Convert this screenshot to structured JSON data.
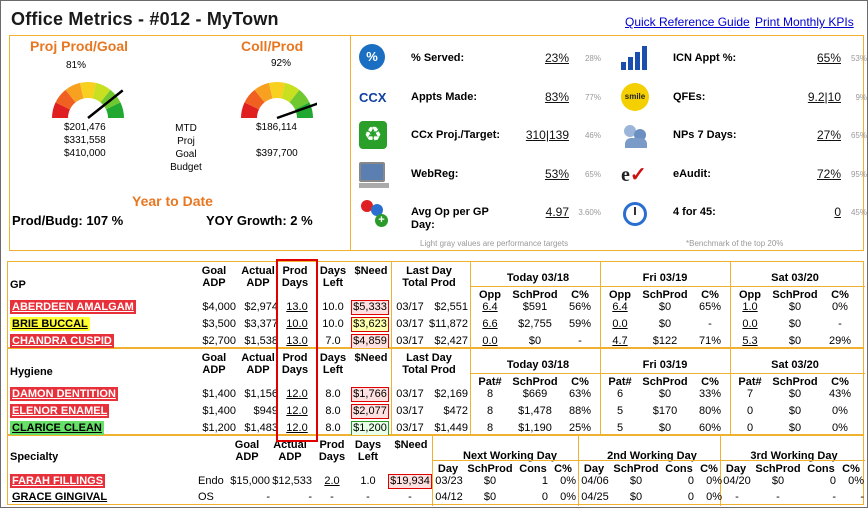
{
  "header": {
    "title": "Office Metrics - #012 - MyTown",
    "link1": "Quick Reference Guide",
    "link2": "Print Monthly KPIs"
  },
  "gauges": {
    "g1": {
      "title": "Proj Prod/Goal",
      "pct": "81%",
      "level": 0.81,
      "v1": "$201,476",
      "v2": "$331,558",
      "v3": "$410,000"
    },
    "g2": {
      "title": "Coll/Prod",
      "pct": "92%",
      "level": 0.92,
      "v1": "$186,114",
      "v2": "$397,700"
    },
    "labels": {
      "l1": "MTD",
      "l2": "Proj",
      "l3": "Goal",
      "l4": "Budget"
    },
    "ytd": "Year to Date",
    "prod_budg": "Prod/Budg: 107 %",
    "yoy": "YOY Growth: 2 %"
  },
  "kpis": {
    "left": [
      {
        "label": "% Served:",
        "value": "23%",
        "bench": "28%",
        "icon": "percent-icon",
        "color": "#1b6fc2"
      },
      {
        "label": "Appts Made:",
        "value": "83%",
        "bench": "77%",
        "icon": "ccx-icon",
        "color": "#1040a0"
      },
      {
        "label": "CCx Proj./Target:",
        "value": "310|139",
        "bench": "46%",
        "icon": "recycle-icon",
        "color": "#2aa02a"
      },
      {
        "label": "WebReg:",
        "value": "53%",
        "bench": "65%",
        "icon": "computer-icon",
        "color": "#5a7fb0"
      },
      {
        "label": "Avg Op per GP Day:",
        "value": "4.97",
        "bench": "3.60%",
        "icon": "people-add-icon",
        "color": "#2a6fd0"
      }
    ],
    "right": [
      {
        "label": "ICN Appt %:",
        "value": "65%",
        "bench": "53%",
        "icon": "bar-chart-icon",
        "color": "#1a4fb0"
      },
      {
        "label": "QFEs:",
        "value": "9.2|10",
        "bench": "9%",
        "icon": "smile-icon",
        "color": "#f5d000"
      },
      {
        "label": "NPs 7 Days:",
        "value": "27%",
        "bench": "65%",
        "icon": "new-patients-icon",
        "color": "#6a8fc0"
      },
      {
        "label": "eAudit:",
        "value": "72%",
        "bench": "95%",
        "icon": "eaudit-icon",
        "color": "#cc1010"
      },
      {
        "label": "4 for 45:",
        "value": "0",
        "bench": "45%",
        "icon": "stopwatch-icon",
        "color": "#2a6fd0"
      }
    ],
    "note1": "Light gray values are performance targets",
    "note2": "*Benchmark of the top 20%"
  },
  "gp": {
    "headers": {
      "section": "GP",
      "goal": "Goal ADP",
      "actual": "Actual ADP",
      "prod": "Prod Days",
      "left": "Days Left",
      "need": "$Need",
      "last": "Last Day Total Prod",
      "d1": "Today 03/18",
      "d2": "Fri 03/19",
      "d3": "Sat 03/20",
      "opp": "Opp",
      "sch": "SchProd",
      "c": "C%"
    },
    "rows": [
      {
        "name": "ABERDEEN AMALGAM",
        "bg": "#e8303a",
        "fg": "#ffffff",
        "goal": "$4,000",
        "actual": "$2,974",
        "prod": "13.0",
        "left": "10.0",
        "need": "$5,333",
        "nb": "#e00000",
        "nbg": "#ffe0e0",
        "ld": "03/17",
        "lp": "$2,551",
        "a1": "6.4",
        "s1": "$591",
        "c1": "56%",
        "a2": "6.4",
        "s2": "$0",
        "c2": "65%",
        "a3": "1.0",
        "s3": "$0",
        "c3": "0%"
      },
      {
        "name": "BRIE BUCCAL",
        "bg": "#ffff33",
        "fg": "#000000",
        "goal": "$3,500",
        "actual": "$3,377",
        "prod": "10.0",
        "left": "10.0",
        "need": "$3,623",
        "nb": "#e00000",
        "nbg": "#ffffb0",
        "ld": "03/17",
        "lp": "$11,872",
        "a1": "6.6",
        "s1": "$2,755",
        "c1": "59%",
        "a2": "0.0",
        "s2": "$0",
        "c2": "-",
        "a3": "0.0",
        "s3": "$0",
        "c3": "-"
      },
      {
        "name": "CHANDRA CUSPID",
        "bg": "#e8303a",
        "fg": "#ffffff",
        "goal": "$2,700",
        "actual": "$1,538",
        "prod": "13.0",
        "left": "7.0",
        "need": "$4,859",
        "nb": "#e00000",
        "nbg": "#ffe0e0",
        "ld": "03/17",
        "lp": "$2,427",
        "a1": "0.0",
        "s1": "$0",
        "c1": "-",
        "a2": "4.7",
        "s2": "$122",
        "c2": "71%",
        "a3": "5.3",
        "s3": "$0",
        "c3": "29%"
      }
    ]
  },
  "hyg": {
    "headers": {
      "section": "Hygiene",
      "goal": "Goal ADP",
      "actual": "Actual ADP",
      "prod": "Prod Days",
      "left": "Days Left",
      "need": "$Need",
      "last": "Last Day Total Prod",
      "d1": "Today 03/18",
      "d2": "Fri 03/19",
      "d3": "Sat 03/20",
      "pat": "Pat#",
      "sch": "SchProd",
      "c": "C%"
    },
    "rows": [
      {
        "name": "DAMON DENTITION",
        "bg": "#e8303a",
        "fg": "#ffffff",
        "goal": "$1,400",
        "actual": "$1,156",
        "prod": "12.0",
        "left": "8.0",
        "need": "$1,766",
        "nb": "#e00000",
        "nbg": "#ffe0e0",
        "ld": "03/17",
        "lp": "$2,169",
        "p1": "8",
        "s1": "$669",
        "c1": "63%",
        "p2": "6",
        "s2": "$0",
        "c2": "33%",
        "p3": "7",
        "s3": "$0",
        "c3": "43%"
      },
      {
        "name": "ELENOR ENAMEL",
        "bg": "#e8303a",
        "fg": "#ffffff",
        "goal": "$1,400",
        "actual": "$949",
        "prod": "12.0",
        "left": "8.0",
        "need": "$2,077",
        "nb": "#e00000",
        "nbg": "#ffe0e0",
        "ld": "03/17",
        "lp": "$472",
        "p1": "8",
        "s1": "$1,478",
        "c1": "88%",
        "p2": "5",
        "s2": "$170",
        "c2": "80%",
        "p3": "0",
        "s3": "$0",
        "c3": "0%"
      },
      {
        "name": "CLARICE CLEAN",
        "bg": "#66e066",
        "fg": "#000000",
        "goal": "$1,200",
        "actual": "$1,483",
        "prod": "12.0",
        "left": "8.0",
        "need": "$1,200",
        "nb": "#2a9a2a",
        "nbg": "#e8ffe8",
        "ld": "03/17",
        "lp": "$1,449",
        "p1": "8",
        "s1": "$1,190",
        "c1": "25%",
        "p2": "5",
        "s2": "$0",
        "c2": "60%",
        "p3": "0",
        "s3": "$0",
        "c3": "0%"
      }
    ]
  },
  "spec": {
    "headers": {
      "section": "Specialty",
      "goal": "Goal ADP",
      "actual": "Actual ADP",
      "prod": "Prod Days",
      "left": "Days Left",
      "need": "$Need",
      "d1": "Next Working Day",
      "d2": "2nd Working Day",
      "d3": "3rd Working Day",
      "day": "Day",
      "sch": "SchProd",
      "cons": "Cons",
      "c": "C%"
    },
    "rows": [
      {
        "name": "FARAH FILLINGS",
        "type": "Endo",
        "bg": "#e8303a",
        "fg": "#ffffff",
        "goal": "$15,000",
        "actual": "$12,533",
        "prod": "2.0",
        "left": "1.0",
        "need": "$19,934",
        "nb": "#e00000",
        "nbg": "#ffe0e0",
        "d1": "03/23",
        "s1": "$0",
        "n1": "1",
        "c1": "0%",
        "d2": "04/06",
        "s2": "$0",
        "n2": "0",
        "c2": "0%",
        "d3": "04/20",
        "s3": "$0",
        "n3": "0",
        "c3": "0%"
      },
      {
        "name": "GRACE GINGIVAL",
        "type": "OS",
        "bg": "#ffffff",
        "fg": "#000000",
        "goal": "-",
        "actual": "-",
        "prod": "-",
        "left": "-",
        "need": "-",
        "nb": "",
        "nbg": "",
        "d1": "04/12",
        "s1": "$0",
        "n1": "0",
        "c1": "0%",
        "d2": "04/25",
        "s2": "$0",
        "n2": "0",
        "c2": "0%",
        "d3": "-",
        "s3": "-",
        "n3": "-",
        "c3": "-"
      }
    ]
  }
}
